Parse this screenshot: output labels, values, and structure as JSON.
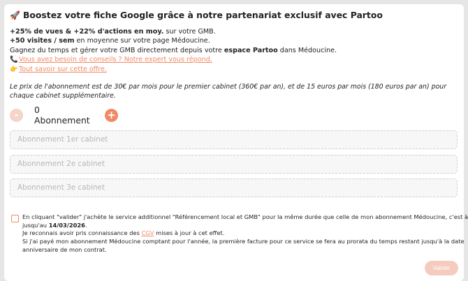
{
  "title": {
    "emoji": "🚀",
    "text": "Boostez votre fiche Google grâce à notre partenariat exclusif avec Partoo"
  },
  "info": {
    "line1_bold": "+25% de vues & +22% d'actions en moy.",
    "line1_rest": " sur votre GMB.",
    "line2_bold": "+50 visites / sem",
    "line2_rest": " en moyenne sur votre page Médoucine.",
    "line3_pre": "Gagnez du temps et gérer votre GMB directement depuis votre ",
    "line3_bold": "espace Partoo",
    "line3_post": " dans Médoucine.",
    "phone_emoji": "📞",
    "expert_link": "Vous avez besoin de conseils ? Notre expert vous répond.",
    "finger_emoji": "👉",
    "offer_link": "Tout savoir sur cette offre."
  },
  "price_text": "Le prix de l'abonnement est de 30€ par mois pour le premier cabinet (360€ par an), et de 15 euros par mois (180 euros par an) pour chaque cabinet supplémentaire.",
  "stepper": {
    "minus_symbol": "-",
    "count_label": "0 Abonnement",
    "plus_symbol": "+"
  },
  "fields": [
    {
      "placeholder": "Abonnement 1er cabinet"
    },
    {
      "placeholder": "Abonnement 2e cabinet"
    },
    {
      "placeholder": "Abonnement 3e cabinet"
    }
  ],
  "terms": {
    "line1": "En cliquant \"valider\" j'achète le service additionnel \"Référencement local et GMB\" pour la même durée que celle de mon abonnement Médoucine, c'est à dire",
    "line2_pre": "jusqu'au ",
    "date": "14/03/2026",
    "line2_post": ".",
    "line3_pre": "Je reconnais avoir pris connaissance des ",
    "cgv": "CGV",
    "line3_post": " mises à jour à cet effet.",
    "line4": "Si j'ai payé mon abonnement Médoucine comptant pour l'année, la première facture pour ce service se fera au prorata du temps restant jusqu'à la date",
    "line5": "anniversaire de mon contrat."
  },
  "submit_label": "Valider",
  "colors": {
    "accent": "#ef8a65",
    "accent_light": "#f5d4c9",
    "button_disabled": "#f5cbbd"
  }
}
